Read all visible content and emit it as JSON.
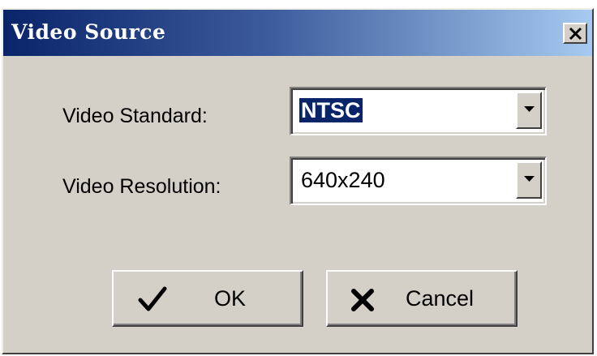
{
  "window": {
    "title": "Video Source",
    "close_label": "close"
  },
  "fields": [
    {
      "label": "Video Standard:",
      "value": "NTSC",
      "selected": true
    },
    {
      "label": "Video Resolution:",
      "value": "640x240",
      "selected": false
    }
  ],
  "buttons": {
    "ok_label": "OK",
    "ok_icon": "checkmark-icon",
    "cancel_label": "Cancel",
    "cancel_icon": "x-icon"
  },
  "colors": {
    "titlebar_start": "#0a246a",
    "titlebar_end": "#a6caf0",
    "face": "#d4d0c8",
    "selection": "#0a246a"
  }
}
